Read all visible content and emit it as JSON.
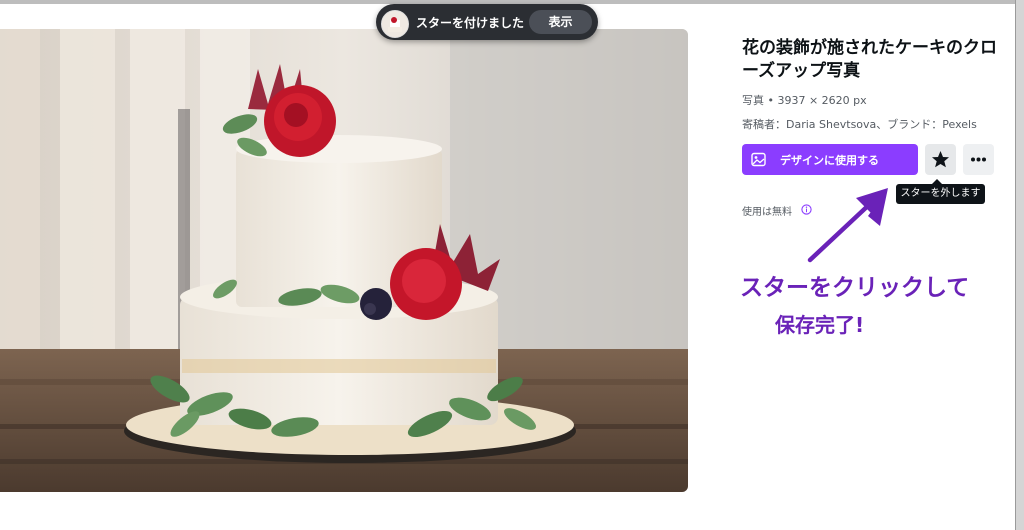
{
  "toast": {
    "message": "スターを付けました",
    "action_label": "表示"
  },
  "photo": {
    "subject": "cake-photo"
  },
  "detail": {
    "title": "花の装飾が施されたケーキのクローズアップ写真",
    "meta": "写真 • 3937 × 2620 px",
    "author": "寄稿者：Daria Shevtsova、ブランド：Pexels",
    "use_button_label": "デザインに使用する",
    "star_tooltip": "スターを外します",
    "free_label": "使用は無料"
  },
  "annotation": {
    "line1": "スターをクリックして",
    "line2": "保存完了!"
  },
  "colors": {
    "accent": "#8b3dff",
    "annotation": "#6a22b8",
    "toast_bg": "#2b2e33"
  },
  "icons": {
    "use_button": "image-icon",
    "star": "star-icon",
    "more": "ellipsis-icon",
    "info": "info-icon",
    "arrow": "arrow-annotation"
  }
}
